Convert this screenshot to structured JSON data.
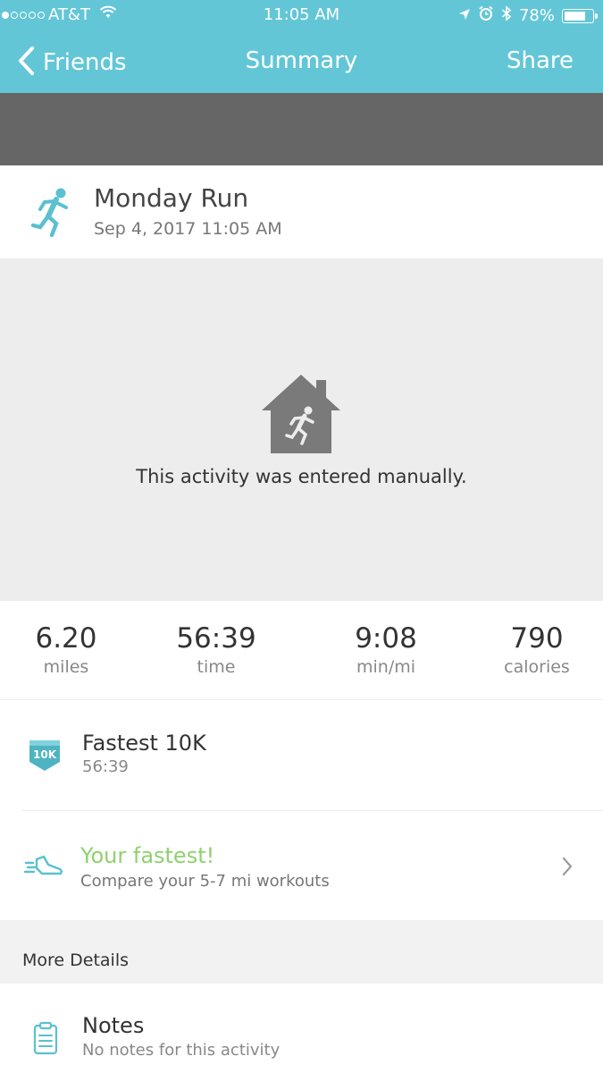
{
  "status_bar": {
    "carrier": "AT&T",
    "time": "11:05 AM",
    "battery": "78%",
    "battery_level": 0.78,
    "signal_bars_filled": 1,
    "signal_bars_total": 5,
    "icons": [
      "wifi-icon",
      "location-arrow-icon",
      "alarm-icon",
      "bluetooth-icon",
      "battery-icon"
    ]
  },
  "nav": {
    "back_label": "Friends",
    "title": "Summary",
    "share_label": "Share",
    "color": "#63c6d6"
  },
  "activity": {
    "icon": "runner-icon",
    "title": "Monday Run",
    "date": "Sep 4, 2017 11:05 AM",
    "manual_icon": "house-runner-icon",
    "manual_message": "This activity was entered manually."
  },
  "stats": [
    {
      "value": "6.20",
      "label": "miles"
    },
    {
      "value": "56:39",
      "label": "time"
    },
    {
      "value": "9:08",
      "label": "min/mi"
    },
    {
      "value": "790",
      "label": "calories"
    }
  ],
  "achievement": {
    "badge_text": "10K",
    "title": "Fastest 10K",
    "subtitle": "56:39"
  },
  "compare": {
    "icon": "shoe-icon",
    "title": "Your fastest!",
    "subtitle": "Compare your 5-7 mi workouts",
    "accent": "#8fd16e"
  },
  "more_details": {
    "section_title": "More Details",
    "notes_title": "Notes",
    "notes_subtitle": "No notes for this activity"
  }
}
